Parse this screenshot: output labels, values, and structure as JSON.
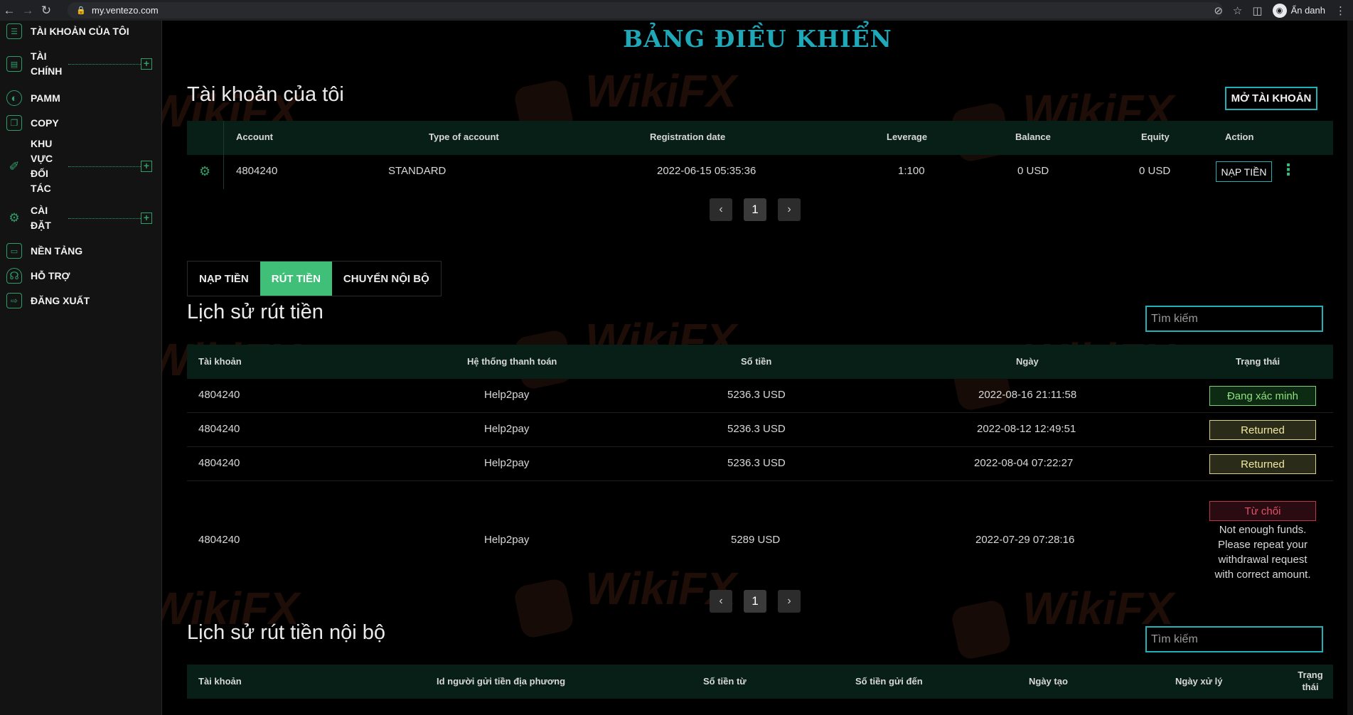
{
  "browser": {
    "url": "my.ventezo.com",
    "profile_label": "Ẩn danh"
  },
  "sidebar": {
    "items": [
      {
        "label": "TÀI KHOẢN CỦA TÔI",
        "icon": "list-icon"
      },
      {
        "label": "TÀI CHÍNH",
        "icon": "finance-icon",
        "expandable": true
      },
      {
        "label": "PAMM",
        "icon": "globe-icon"
      },
      {
        "label": "COPY",
        "icon": "copy-icon"
      },
      {
        "label": "KHU VỰC ĐỐI TÁC",
        "icon": "partner-icon",
        "expandable": true
      },
      {
        "label": "CÀI ĐẶT",
        "icon": "settings-user-icon",
        "expandable": true
      },
      {
        "label": "NỀN TẢNG",
        "icon": "platform-icon"
      },
      {
        "label": "HỖ TRỢ",
        "icon": "headset-icon"
      },
      {
        "label": "ĐĂNG XUẤT",
        "icon": "logout-icon"
      }
    ]
  },
  "dashboard_title": "BẢNG ĐIỀU KHIỂN",
  "accounts": {
    "title": "Tài khoản của tôi",
    "open_button": "MỞ TÀI KHOẢN",
    "columns": [
      "Account",
      "Type of account",
      "Registration date",
      "Leverage",
      "Balance",
      "Equity",
      "Action"
    ],
    "rows": [
      {
        "account": "4804240",
        "type": "STANDARD",
        "date": "2022-06-15 05:35:36",
        "leverage": "1:100",
        "balance": "0 USD",
        "equity": "0 USD",
        "action": "NẠP TIỀN"
      }
    ],
    "page": "1"
  },
  "tabs": [
    "NẠP TIỀN",
    "RÚT TIỀN",
    "CHUYỂN NỘI BỘ"
  ],
  "active_tab": "RÚT TIỀN",
  "withdraw_history": {
    "title": "Lịch sử rút tiền",
    "search_placeholder": "Tìm kiếm",
    "columns": [
      "Tài khoản",
      "Hệ thống thanh toán",
      "Số tiền",
      "Ngày",
      "Trạng thái"
    ],
    "rows": [
      {
        "account": "4804240",
        "system": "Help2pay",
        "amount": "5236.3 USD",
        "date": "2022-08-16 21:11:58",
        "status": "Đang xác minh",
        "status_kind": "verify"
      },
      {
        "account": "4804240",
        "system": "Help2pay",
        "amount": "5236.3 USD",
        "date": "2022-08-12 12:49:51",
        "status": "Returned",
        "status_kind": "returned"
      },
      {
        "account": "4804240",
        "system": "Help2pay",
        "amount": "5236.3 USD",
        "date": "2022-08-04 07:22:27",
        "status": "Returned",
        "status_kind": "returned"
      },
      {
        "account": "4804240",
        "system": "Help2pay",
        "amount": "5289 USD",
        "date": "2022-07-29 07:28:16",
        "status": "Từ chối",
        "status_kind": "rejected",
        "note": "Not enough funds. Please repeat your withdrawal request with correct amount."
      }
    ],
    "page": "1"
  },
  "internal_history": {
    "title": "Lịch sử rút tiền nội bộ",
    "search_placeholder": "Tìm kiếm",
    "columns": [
      "Tài khoản",
      "Id người gửi tiền địa phương",
      "Số tiền từ",
      "Số tiền gửi đến",
      "Ngày tạo",
      "Ngày xử lý",
      "Trạng thái"
    ]
  },
  "watermark_text": "WikiFX",
  "colors": {
    "accent_teal": "#1fa8b8",
    "accent_green": "#3fbf78",
    "header_bg": "#071f16",
    "sidebar_bg": "#131313"
  }
}
